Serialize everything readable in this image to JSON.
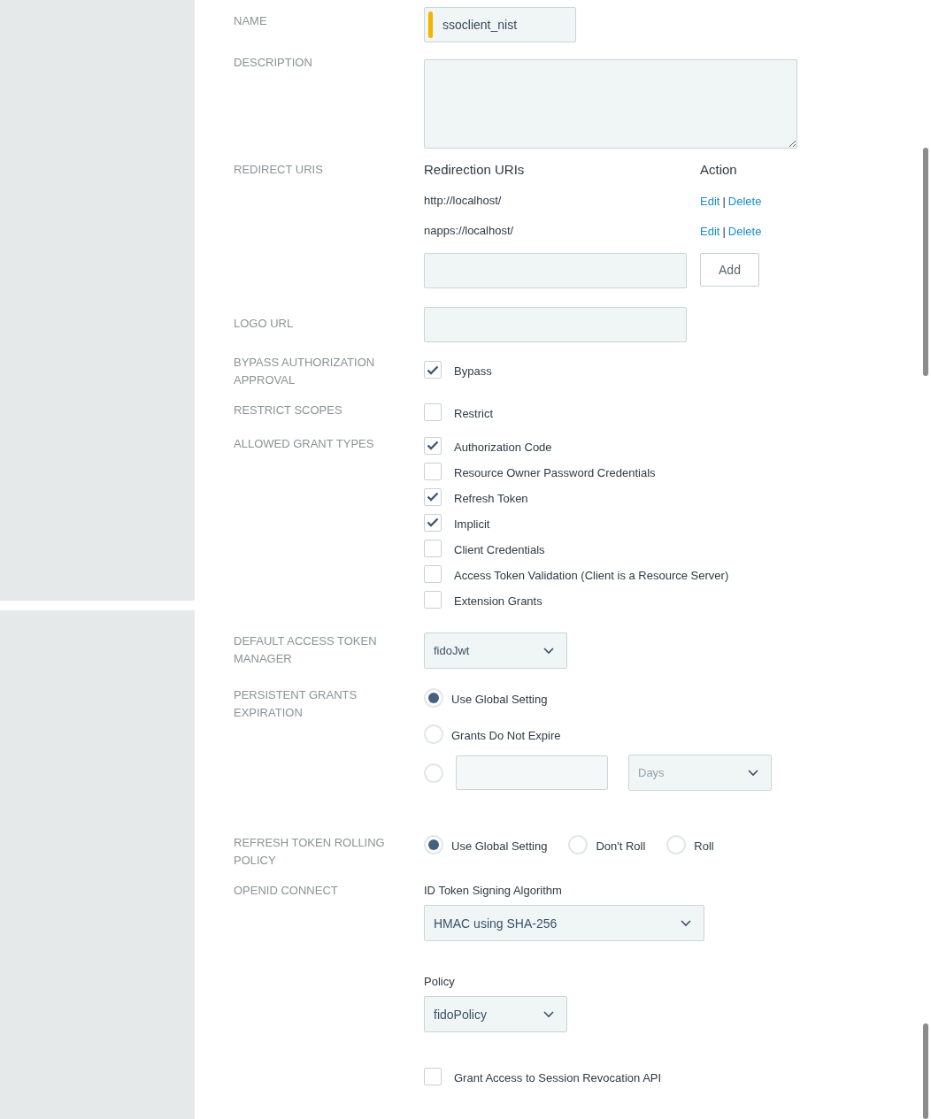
{
  "name": {
    "label": "NAME",
    "value": "ssoclient_nist"
  },
  "description": {
    "label": "DESCRIPTION"
  },
  "redirect_uris": {
    "label": "REDIRECT URIS",
    "columns": [
      "Redirection URIs",
      "Action"
    ],
    "rows": [
      {
        "uri": "http://localhost/",
        "edit": "Edit",
        "separator": "|",
        "delete": "Delete"
      },
      {
        "uri": "napps://localhost/",
        "edit": "Edit",
        "separator": "|",
        "delete": "Delete"
      }
    ],
    "add_button": "Add"
  },
  "logo_url": {
    "label": "LOGO URL"
  },
  "bypass": {
    "label": [
      "BYPASS AUTHORIZATION",
      "APPROVAL"
    ],
    "option": {
      "label": "Bypass",
      "checked": true
    }
  },
  "restrict": {
    "label": [
      "RESTRICT SCOPES"
    ],
    "option": {
      "label": "Restrict",
      "checked": false
    }
  },
  "grant_types": {
    "label": "ALLOWED GRANT TYPES",
    "options": [
      {
        "label": "Authorization Code",
        "checked": true
      },
      {
        "label": "Resource Owner Password Credentials",
        "checked": false
      },
      {
        "label": "Refresh Token",
        "checked": true
      },
      {
        "label": "Implicit",
        "checked": true
      },
      {
        "label": "Client Credentials",
        "checked": false
      },
      {
        "label": "Access Token Validation (Client is a Resource Server)",
        "checked": false
      },
      {
        "label": "Extension Grants",
        "checked": false
      }
    ]
  },
  "access_token_manager": {
    "label": [
      "DEFAULT ACCESS TOKEN",
      "MANAGER"
    ],
    "value": "fidoJwt"
  },
  "persistent_grants": {
    "label": [
      "PERSISTENT GRANTS",
      "EXPIRATION"
    ],
    "options": [
      {
        "label": "Use Global Setting",
        "selected": true
      },
      {
        "label": "Grants Do Not Expire",
        "selected": false
      }
    ],
    "custom": {
      "selected": false,
      "unit": "Days"
    }
  },
  "refresh_rolling": {
    "label": [
      "REFRESH TOKEN ROLLING",
      "POLICY"
    ],
    "options": [
      {
        "label": "Use Global Setting",
        "selected": true
      },
      {
        "label": "Don't Roll",
        "selected": false
      },
      {
        "label": "Roll",
        "selected": false
      }
    ]
  },
  "openid": {
    "label": "OPENID CONNECT",
    "algorithm_label": "ID Token Signing Algorithm",
    "algorithm": "HMAC using SHA-256",
    "policy_label": "Policy",
    "policy": "fidoPolicy",
    "session_revocation": {
      "label": "Grant Access to Session Revocation API",
      "checked": false
    }
  }
}
